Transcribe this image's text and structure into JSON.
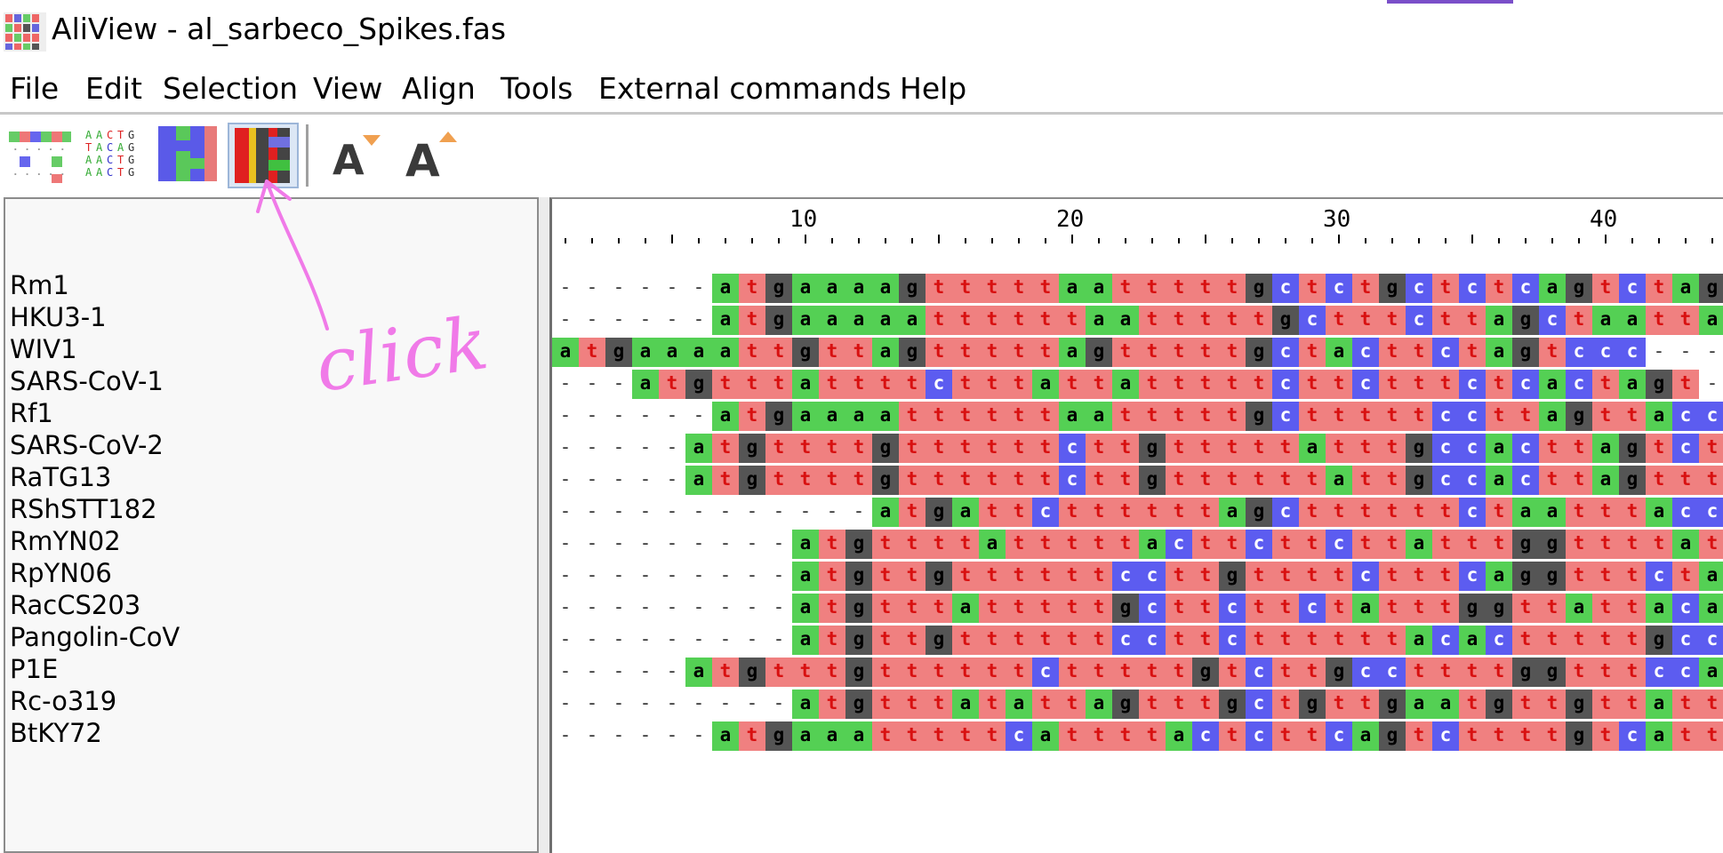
{
  "window": {
    "title": "AliView - al_sarbeco_Spikes.fas",
    "accent_color": "#7a4fc9"
  },
  "menu": [
    "File",
    "Edit",
    "Selection",
    "View",
    "Align",
    "Tools",
    "External commands",
    "Help"
  ],
  "toolbar": {
    "buttons": [
      {
        "name": "highlight-diffs-button",
        "icon": "highlight-diffs-icon",
        "active": false
      },
      {
        "name": "translate-letters-button",
        "icon": "nucleotide-letters-icon",
        "active": false
      },
      {
        "name": "color-scheme-button",
        "icon": "color-blocks-icon",
        "active": false
      },
      {
        "name": "full-color-button",
        "icon": "full-color-icon",
        "active": true
      },
      {
        "name": "decrease-font-button",
        "icon": "font-decrease-icon",
        "active": false
      },
      {
        "name": "increase-font-button",
        "icon": "font-increase-icon",
        "active": false
      }
    ]
  },
  "annotation": {
    "text": "click",
    "color": "#f07ae8"
  },
  "ruler": {
    "labels": [
      "10",
      "20",
      "30",
      "40"
    ]
  },
  "colors": {
    "a": {
      "bg": "#54d054",
      "fg": "#000000"
    },
    "t": {
      "bg": "#f08080",
      "fg": "#d81010"
    },
    "g": {
      "bg": "#555555",
      "fg": "#000000"
    },
    "c": {
      "bg": "#5c5cf0",
      "fg": "#ffffff"
    },
    "-": {
      "bg": "#ffffff",
      "fg": "#000000"
    }
  },
  "sequences": [
    {
      "name": "Rm1",
      "seq": "------atgaaaagtttttaatttttgctctgctctcagtctagc"
    },
    {
      "name": "HKU3-1",
      "seq": "------atgaaaaattttttaatttttgctttcttagctaattag"
    },
    {
      "name": "WIV1",
      "seq": "atgaaaattgttagtttttagtttttgctacttctagtccc---tc"
    },
    {
      "name": "SARS-CoV-1",
      "seq": "---atgtttattttctttattatttttcttctttctcactagt---gg"
    },
    {
      "name": "Rf1",
      "seq": "------atgaaaattttttaatttttgctttttccttagttacccagt"
    },
    {
      "name": "SARS-CoV-2",
      "seq": "-----atgttttgttttttcttgtttttatttgccacttagtcttcagt"
    },
    {
      "name": "RaTG13",
      "seq": "-----atgttttgttttttcttgttttttattgccacttagttttcagt"
    },
    {
      "name": "RShSTT182",
      "seq": "------------atgattcttttttagcttttttctaatttaccattagt"
    },
    {
      "name": "RmYN02",
      "seq": "---------atgttttatttttacttcttcttatttggttttatacaggcagc"
    },
    {
      "name": "RpYN06",
      "seq": "---------atgttgttttttccttgttttctttcaggtttctacttagt"
    },
    {
      "name": "RacCS203",
      "seq": "---------atgtttatttttgcttcttctatttggttattacaagcagc"
    },
    {
      "name": "Pangolin-CoV",
      "seq": "---------atgttgttttttccttcttttttacactttttgccttagt"
    },
    {
      "name": "P1E",
      "seq": "-----atgtttgttttttctttttgtcttgccttttggtttccagt"
    },
    {
      "name": "Rc-o319",
      "seq": "---------atgtttatattagtttgctgttgaatgttgttattcagtg"
    },
    {
      "name": "BtKY72",
      "seq": "------atgaaatttttcattttactcttcagtcttttgtcattttcagt"
    }
  ]
}
